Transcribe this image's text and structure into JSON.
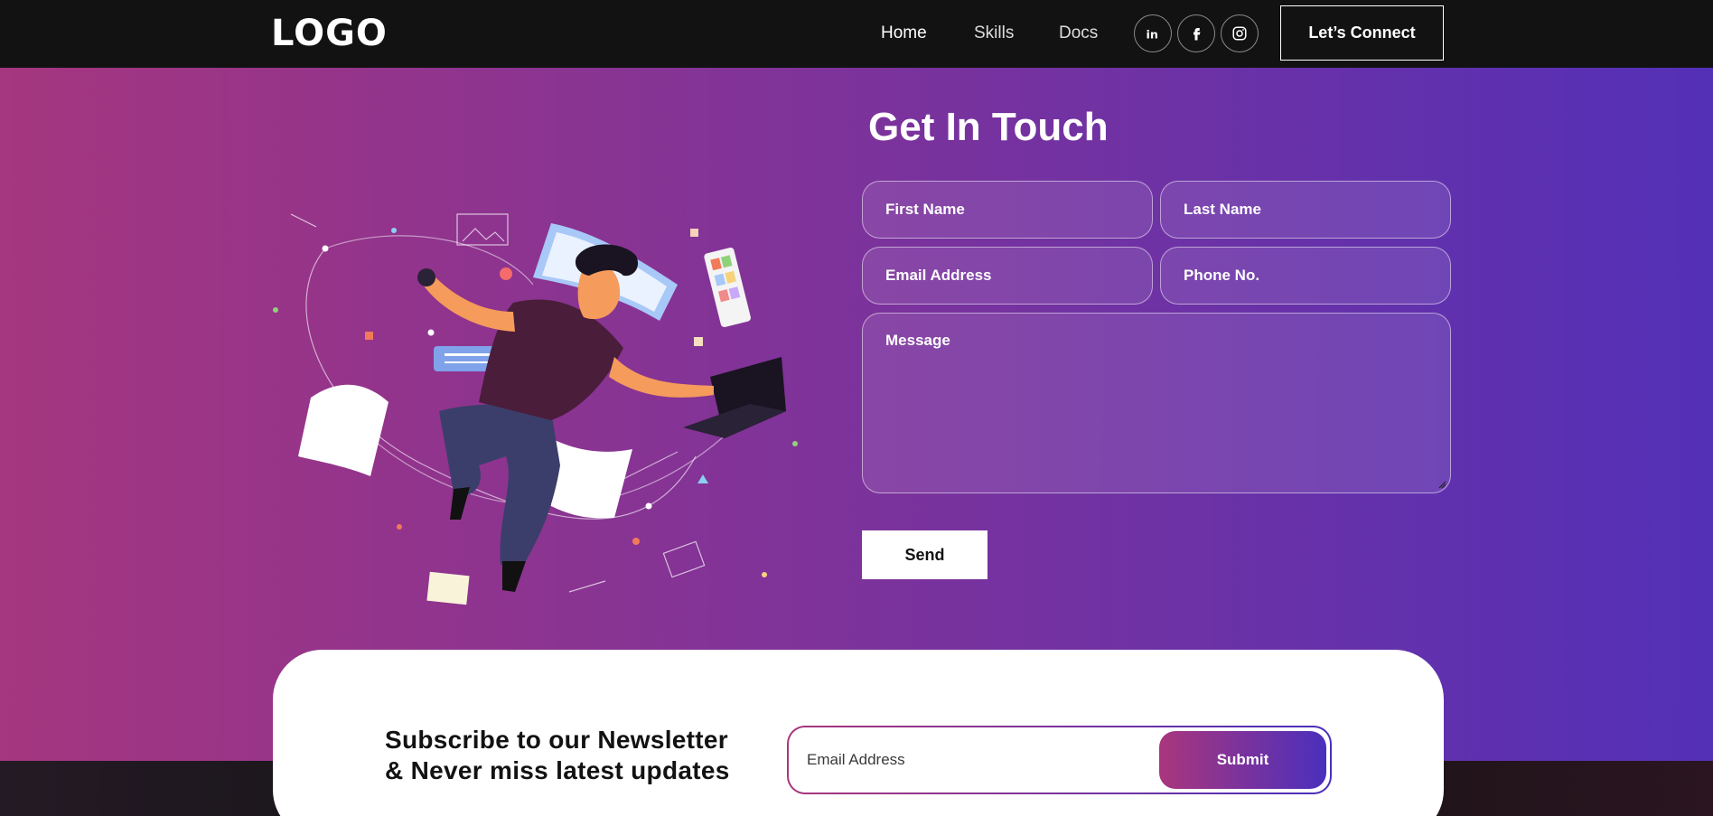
{
  "nav": {
    "logo": "LOGO",
    "links": [
      "Home",
      "Skills",
      "Docs"
    ],
    "social": [
      "linkedin-icon",
      "facebook-icon",
      "instagram-icon"
    ],
    "connect_label": "Let’s Connect"
  },
  "contact": {
    "title": "Get In Touch",
    "fields": {
      "first_name": "First Name",
      "last_name": "Last Name",
      "email": "Email Address",
      "phone": "Phone No.",
      "message": "Message"
    },
    "send_label": "Send"
  },
  "newsletter": {
    "title_line1": "Subscribe to our Newsletter",
    "title_line2": "& Never miss latest updates",
    "email_placeholder": "Email Address",
    "submit_label": "Submit"
  },
  "colors": {
    "gradient_start": "#AA367C",
    "gradient_end": "#4A2FBD",
    "navbar": "#121212"
  }
}
